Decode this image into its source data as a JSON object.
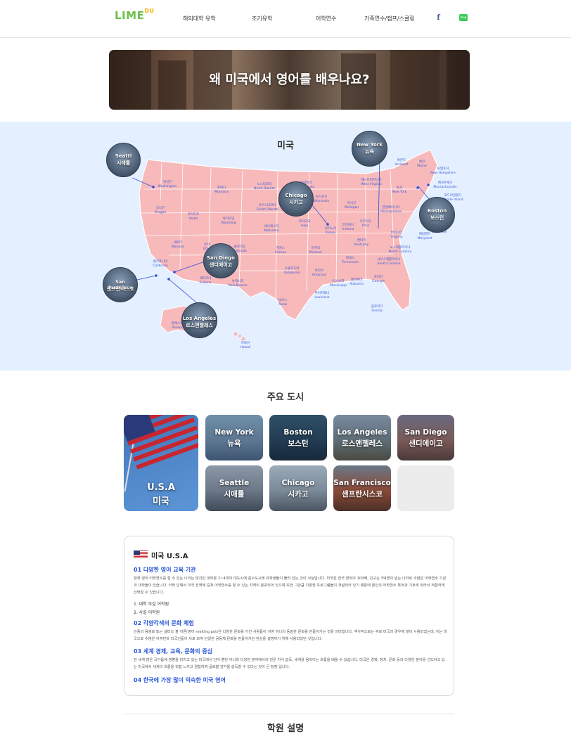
{
  "header": {
    "logo_main": "LIME",
    "logo_sup": "DU",
    "nav": [
      "해외대학 유학",
      "조기유학",
      "어학연수",
      "가족연수/캠프/스쿨링"
    ],
    "facebook_icon": "facebook-icon",
    "blog_icon": "blog-icon",
    "blog_label": "blog"
  },
  "hero": {
    "title": "왜 미국에서 영어를 배우나요?"
  },
  "map": {
    "title": "미국",
    "states": [
      {
        "ko": "워싱턴",
        "en": "Washington"
      },
      {
        "ko": "몬태나",
        "en": "Montana"
      },
      {
        "ko": "노스다코타",
        "en": "North Dakota"
      },
      {
        "ko": "미네소타",
        "en": "Minnesota"
      },
      {
        "ko": "위스콘신",
        "en": "Wisconsin"
      },
      {
        "ko": "미시간",
        "en": "Michigan"
      },
      {
        "ko": "버몬트",
        "en": "Vermont"
      },
      {
        "ko": "메인",
        "en": "Maine"
      },
      {
        "ko": "뉴햄프셔",
        "en": "New Hampshire"
      },
      {
        "ko": "매사추세츠",
        "en": "Massachusetts"
      },
      {
        "ko": "로드아일랜드",
        "en": "Rhode Island"
      },
      {
        "ko": "뉴욕",
        "en": "New York"
      },
      {
        "ko": "오리건",
        "en": "Oregon"
      },
      {
        "ko": "아이다호",
        "en": "Idaho"
      },
      {
        "ko": "와이오밍",
        "en": "Wyoming"
      },
      {
        "ko": "사우스다코타",
        "en": "South Dakota"
      },
      {
        "ko": "아이오와",
        "en": "Iowa"
      },
      {
        "ko": "일리노이",
        "en": "Illinois"
      },
      {
        "ko": "인디애나",
        "en": "Indiana"
      },
      {
        "ko": "오하이오",
        "en": "Ohio"
      },
      {
        "ko": "펜실베이니아",
        "en": "Pennsylvania"
      },
      {
        "ko": "웨스트버지니아",
        "en": "West Virginia"
      },
      {
        "ko": "델라웨어",
        "en": "Delaware"
      },
      {
        "ko": "메릴랜드",
        "en": "Maryland"
      },
      {
        "ko": "네브래스카",
        "en": "Nebraska"
      },
      {
        "ko": "네바다",
        "en": "Nevada"
      },
      {
        "ko": "유타",
        "en": "Utah"
      },
      {
        "ko": "콜로라도",
        "en": "Colorado"
      },
      {
        "ko": "캔자스",
        "en": "Kansas"
      },
      {
        "ko": "미주리",
        "en": "Missouri"
      },
      {
        "ko": "켄터키",
        "en": "Kentucky"
      },
      {
        "ko": "버지니아",
        "en": "Virginia"
      },
      {
        "ko": "캘리포니아",
        "en": "California"
      },
      {
        "ko": "노스캐롤라이나",
        "en": "North Carolina"
      },
      {
        "ko": "테네시",
        "en": "Tennessee"
      },
      {
        "ko": "사우스캐롤라이나",
        "en": "South Carolina"
      },
      {
        "ko": "애리조나",
        "en": "Arizona"
      },
      {
        "ko": "뉴멕시코",
        "en": "New Mexico"
      },
      {
        "ko": "오클라호마",
        "en": "Oklahoma"
      },
      {
        "ko": "아칸소",
        "en": "Arkansas"
      },
      {
        "ko": "미시시피",
        "en": "Mississippi"
      },
      {
        "ko": "앨라배마",
        "en": "Alabama"
      },
      {
        "ko": "조지아",
        "en": "Georgia"
      },
      {
        "ko": "루이지애나",
        "en": "Louisiana"
      },
      {
        "ko": "텍사스",
        "en": "Texas"
      },
      {
        "ko": "플로리다",
        "en": "Florida"
      },
      {
        "ko": "알래스카",
        "en": "Alaska"
      },
      {
        "ko": "하와이",
        "en": "Hawaii"
      }
    ],
    "cities": [
      {
        "en": "Seattl",
        "ko": "시애틀"
      },
      {
        "en": "New York",
        "ko": "뉴욕"
      },
      {
        "en": "Chicago",
        "ko": "시카고"
      },
      {
        "en": "Boston",
        "ko": "보스턴"
      },
      {
        "en": "San Diego",
        "ko": "샌디에이고"
      },
      {
        "en": "San Francisco",
        "ko": "샌프란시스코"
      },
      {
        "en": "Los Angeles",
        "ko": "로스앤젤레스"
      }
    ]
  },
  "major_cities": {
    "title": "주요 도시",
    "usa": {
      "en": "U.S.A",
      "ko": "미국"
    },
    "tiles": [
      {
        "en": "New York",
        "ko": "뉴욕"
      },
      {
        "en": "Boston",
        "ko": "보스턴"
      },
      {
        "en": "Los Angeles",
        "ko": "로스앤젤레스"
      },
      {
        "en": "San Diego",
        "ko": "샌디에이고"
      },
      {
        "en": "Seattle",
        "ko": "시애틀"
      },
      {
        "en": "Chicago",
        "ko": "시카고"
      },
      {
        "en": "San Francisco",
        "ko": "샌프란시스코"
      }
    ]
  },
  "info": {
    "title": "미국 U.S.A",
    "sections": [
      {
        "heading": "01 다양한 영어 교육 기관",
        "body": "현재 영어 어학연수를 할 수 있는 나라는 많지만 대부분 2~4개의 대도시에 중소도시에 유학생들이 몰려 있는 것이 사실입니다. 미국은 한국 면적의 100배, 인구는 3억명이 넘는 나라로 수많은 어학연수 기관과 대학들이 있습니다. 어학 인해서 미국 전역에 걸쳐 어학연수를 할 수 있는 지역이 분포되어 있으며 또한 그만큼 다양한 프로그램들이 개설되어 있기 때문에 본인의 어학연수 목적과 기호에 따라서 적합하게 선택할 수 있습니다."
      },
      {
        "heading": "02 각양각색의 문화 체험",
        "body": "인종의 용광로 또는 샐러드 볼 이론(영어 melting pot)은 다양한 문화를 가진 사람들이 섞여 하나의 동질한 문화를 만들어가는 것을 의미합니다. 역사적으로는 주로 미국의 경우에 많이 사용되었는데, 이는 미국으로 수많은 이주민과 외국인들이 서로 모여 단일한 공동체 문화를 만들어가던 현상을 설명하기 위해 사용되었던 것입니다."
      },
      {
        "heading": "03 세계 경제, 교육, 문화의 중심",
        "body": "전 세계 많은 국가들에 영향을 미치고 있는 미국에서 언어 뿐만 아니라 다양한 분야에서의 전문 지식 습득, 세계를 움직이는 흐름을 배울 수 있습니다. 미국은 경제, 정치, 문화 등의 다양한 분야를 선도하고 있는 미국에서 세계의 흐름을 직접 느끼고 경험하며 글로벌 감각을 습득할 수 있다는 것이 큰 장점 입니다."
      },
      {
        "heading": "04 한국에 가장 많이 익숙한 미국 영어",
        "body": ""
      }
    ],
    "list": [
      "1. 대학 부설 어학원",
      "2. 사설 어학원"
    ]
  },
  "footer": {
    "title": "학원 설명"
  }
}
